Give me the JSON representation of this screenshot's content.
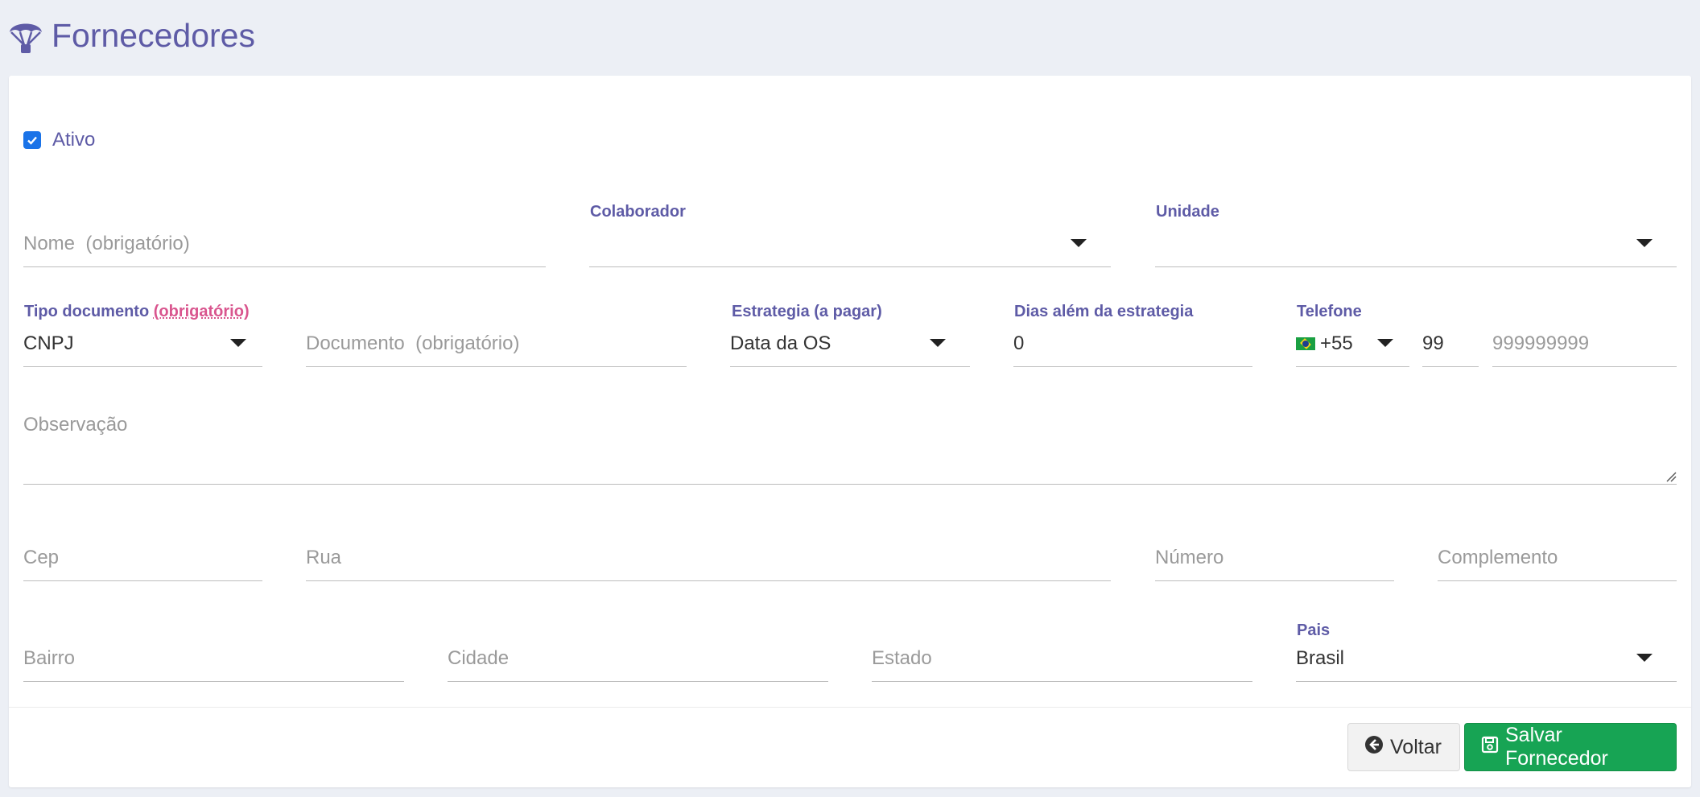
{
  "header": {
    "title": "Fornecedores",
    "icon": "parachute-icon"
  },
  "form": {
    "ativo": {
      "label": "Ativo",
      "checked": true
    },
    "nome": {
      "placeholder": "Nome",
      "required": "(obrigatório)"
    },
    "colaborador": {
      "label": "Colaborador",
      "value": ""
    },
    "unidade": {
      "label": "Unidade",
      "value": ""
    },
    "tipo_documento": {
      "label": "Tipo documento",
      "required": "(obrigatório)",
      "value": "CNPJ"
    },
    "documento": {
      "placeholder": "Documento",
      "required": "(obrigatório)"
    },
    "estrategia": {
      "label": "Estrategia (a pagar)",
      "value": "Data da OS"
    },
    "dias": {
      "label": "Dias além da estrategia",
      "value": "0"
    },
    "telefone": {
      "label": "Telefone",
      "country_code": "+55",
      "ddd": "99",
      "number_placeholder": "999999999"
    },
    "observacao": {
      "placeholder": "Observação"
    },
    "cep": {
      "placeholder": "Cep"
    },
    "rua": {
      "placeholder": "Rua"
    },
    "numero": {
      "placeholder": "Número"
    },
    "complemento": {
      "placeholder": "Complemento"
    },
    "bairro": {
      "placeholder": "Bairro"
    },
    "cidade": {
      "placeholder": "Cidade"
    },
    "estado": {
      "placeholder": "Estado"
    },
    "pais": {
      "label": "Pais",
      "value": "Brasil"
    }
  },
  "buttons": {
    "back": "Voltar",
    "save": "Salvar Fornecedor"
  },
  "colors": {
    "accent": "#5e5ba6",
    "save": "#17a454",
    "required": "#d9558e",
    "checkbox": "#1a73e8"
  }
}
